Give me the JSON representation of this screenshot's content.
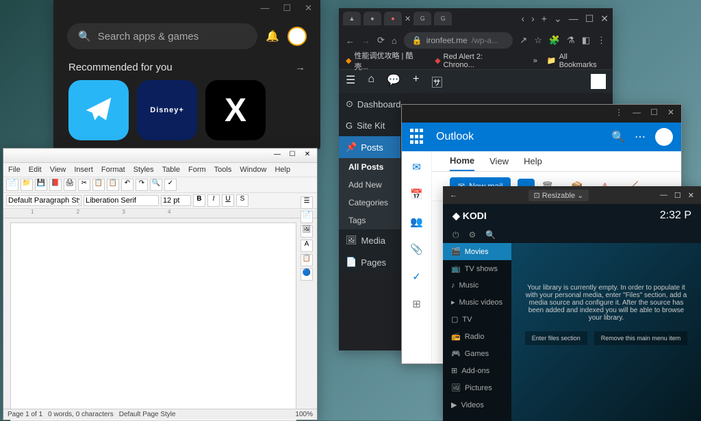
{
  "playstore": {
    "search_placeholder": "Search apps & games",
    "recommended": "Recommended for you",
    "apps": [
      "telegram",
      "Disney+",
      "X"
    ]
  },
  "libre": {
    "menu": [
      "File",
      "Edit",
      "View",
      "Insert",
      "Format",
      "Styles",
      "Table",
      "Form",
      "Tools",
      "Window",
      "Help"
    ],
    "para_style": "Default Paragraph Styl",
    "font": "Liberation Serif",
    "size": "12 pt",
    "status_page": "Page 1 of 1",
    "status_words": "0 words, 0 characters",
    "status_style": "Default Page Style",
    "status_zoom": "100%"
  },
  "chrome": {
    "url_host": "ironfeet.me",
    "url_path": "/wp-a...",
    "bookmark1": "性能调优攻略 | 酷壳...",
    "bookmark2": "Red Alert 2: Chrono...",
    "bookmark_all": "All Bookmarks"
  },
  "wordpress": {
    "items": [
      "Dashboard",
      "Site Kit",
      "Posts",
      "Media",
      "Pages"
    ],
    "subs": [
      "All Posts",
      "Add New",
      "Categories",
      "Tags"
    ]
  },
  "outlook": {
    "title": "Outlook",
    "tabs": [
      "Home",
      "View",
      "Help"
    ],
    "newmail": "New mail"
  },
  "kodi": {
    "resizable": "Resizable",
    "logo": "KODI",
    "time": "2:32 P",
    "menu": [
      "Movies",
      "TV shows",
      "Music",
      "Music videos",
      "TV",
      "Radio",
      "Games",
      "Add-ons",
      "Pictures",
      "Videos"
    ],
    "empty_msg": "Your library is currently empty. In order to populate it with your personal media, enter \"Files\" section, add a media source and configure it. After the source has been added and indexed you will be able to browse your library.",
    "btn1": "Enter files section",
    "btn2": "Remove this main menu item"
  }
}
